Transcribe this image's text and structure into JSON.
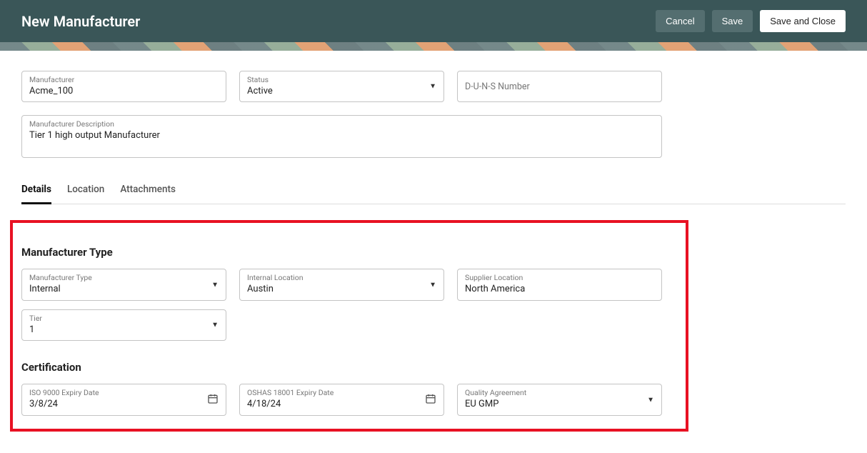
{
  "header": {
    "title": "New Manufacturer",
    "cancel": "Cancel",
    "save": "Save",
    "save_close": "Save and Close"
  },
  "top_fields": {
    "manufacturer_label": "Manufacturer",
    "manufacturer_value": "Acme_100",
    "status_label": "Status",
    "status_value": "Active",
    "duns_placeholder": "D-U-N-S Number",
    "desc_label": "Manufacturer Description",
    "desc_value": "Tier 1 high output Manufacturer"
  },
  "tabs": {
    "details": "Details",
    "location": "Location",
    "attachments": "Attachments"
  },
  "sections": {
    "mfr_type_title": "Manufacturer Type",
    "cert_title": "Certification"
  },
  "mfr_type": {
    "type_label": "Manufacturer Type",
    "type_value": "Internal",
    "internal_loc_label": "Internal Location",
    "internal_loc_value": "Austin",
    "supplier_loc_label": "Supplier Location",
    "supplier_loc_value": "North America",
    "tier_label": "Tier",
    "tier_value": "1"
  },
  "cert": {
    "iso_label": "ISO 9000 Expiry Date",
    "iso_value": "3/8/24",
    "oshas_label": "OSHAS 18001 Expiry Date",
    "oshas_value": "4/18/24",
    "qa_label": "Quality Agreement",
    "qa_value": "EU GMP"
  }
}
